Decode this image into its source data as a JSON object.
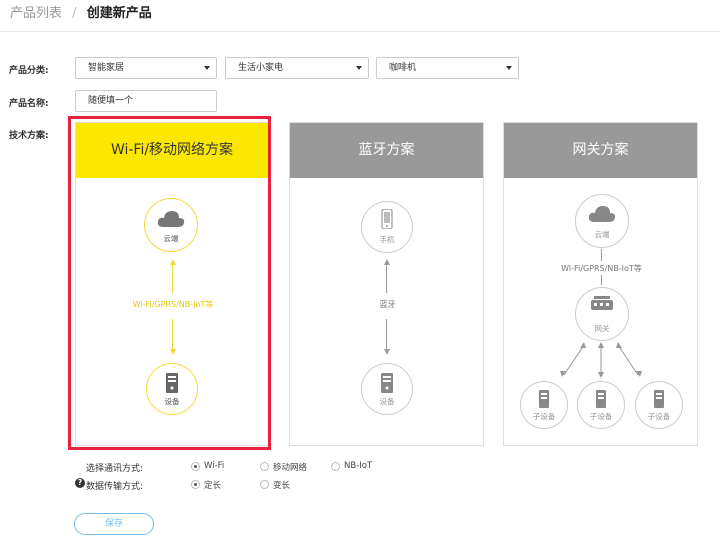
{
  "breadcrumb": {
    "parent": "产品列表",
    "separator": "/",
    "current": "创建新产品"
  },
  "form": {
    "category_label": "产品分类:",
    "category_selects": [
      "智能家居",
      "生活小家电",
      "咖啡机"
    ],
    "name_label": "产品名称:",
    "name_value": "随便填一个",
    "tech_label": "技术方案:"
  },
  "plans": [
    {
      "title": "Wi-Fi/移动网络方案",
      "selected": true,
      "cloud_label": "云端",
      "link_label": "Wi-Fi/GPRS/NB-IoT等",
      "device_label": "设备"
    },
    {
      "title": "蓝牙方案",
      "selected": false,
      "phone_label": "手机",
      "link_label": "蓝牙",
      "device_label": "设备"
    },
    {
      "title": "网关方案",
      "selected": false,
      "cloud_label": "云端",
      "link_label": "Wi-Fi/GPRS/NB-IoT等",
      "gateway_label": "网关",
      "sub_labels": [
        "子设备",
        "子设备",
        "子设备"
      ]
    }
  ],
  "comm": {
    "label": "选择通讯方式:",
    "options": [
      "Wi-Fi",
      "移动网络",
      "NB-IoT"
    ],
    "selected": "Wi-Fi"
  },
  "transfer": {
    "label": "数据传输方式:",
    "options": [
      "定长",
      "变长"
    ],
    "selected": "定长"
  },
  "save_label": "保存",
  "colors": {
    "accent": "#fbe700",
    "selection_border": "#e8213e",
    "card_header": "#999999",
    "button": "#79bde8"
  },
  "icons": [
    "cloud-icon",
    "device-icon",
    "phone-icon",
    "gateway-icon",
    "help-icon",
    "caret-down-icon"
  ]
}
